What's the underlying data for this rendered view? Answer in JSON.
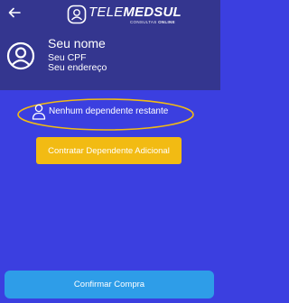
{
  "header": {
    "back_icon": "arrow-left-icon",
    "logo": {
      "text_light": "TELE",
      "text_bold": "MEDSUL",
      "subtext_light": "CONSULTAS",
      "subtext_bold": "ONLINE"
    },
    "avatar_icon": "user-circle-icon",
    "profile": {
      "name": "Seu nome",
      "cpf": "Seu CPF",
      "address": "Seu endereço"
    }
  },
  "dependents": {
    "icon": "person-icon",
    "empty_text": "Nenhum dependente restante",
    "annotation_color": "#f2bb13"
  },
  "buttons": {
    "add_dependent": "Contratar Dependente Adicional",
    "confirm": "Confirmar Compra"
  },
  "colors": {
    "background": "#3b3fe0",
    "header": "#34368f",
    "add_button": "#f2bb13",
    "confirm_button": "#2e9de8"
  }
}
